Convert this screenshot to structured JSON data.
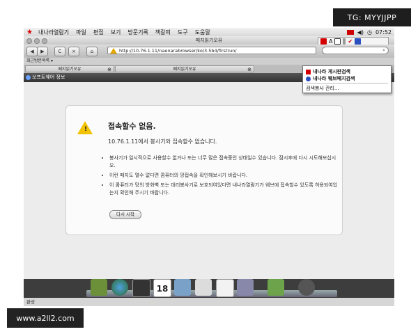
{
  "watermarks": {
    "top_right": "TG: MYYJJPP",
    "bottom_left": "www.a2ll2.com"
  },
  "menubar": {
    "items": [
      "내나라열람기",
      "파일",
      "편집",
      "보기",
      "방문기록",
      "책갈피",
      "도구",
      "도움말"
    ],
    "clock": "07:52"
  },
  "window": {
    "title": "페지읽기오유"
  },
  "toolbar": {
    "back_icon": "back-arrow-icon",
    "forward_icon": "forward-arrow-icon",
    "reload_glyph": "C",
    "stop_glyph": "×",
    "url": "http://10.76.1.11/naenarabrowser/ko/3.5b4/firstrun/"
  },
  "bookmarks": {
    "label": "최근방문목록 ▾"
  },
  "tabs": [
    {
      "label": "페지읽기오유"
    },
    {
      "label": "페지읽기오유"
    }
  ],
  "infobar": {
    "label": "쏘프트웨어 정보"
  },
  "error_page": {
    "title": "접속할수 없음.",
    "subtitle": "10.76.1.11에서 봉사기와 접속할수 없습니다.",
    "bullets": [
      "봉사기가 일시적으로 사용할수 없거나 또는 너무 많은 접속중인 상태일수 있습니다. 잠시후에 다시 시도해보십시오.",
      "이런 페지도 열수 없다면 콤퓨터의 망접속을 확인해보시기 바랍니다.",
      "이 콤퓨터가 망의 방화벽 또는 대리봉사기로 보호되여있다면 내나라열람기가 웨브에 접속할수 있도록 허용되여있는지 확인해 주시기 바랍니다."
    ],
    "retry_label": "다시 시작"
  },
  "search_dropdown": {
    "items": [
      {
        "label": "내나라 게시판검색",
        "icon": "board-search-icon"
      },
      {
        "label": "내나라 웨브페지검색",
        "icon": "web-search-icon"
      }
    ],
    "manage_label": "검색봉사 관리..."
  },
  "statusbar": {
    "label": "완성"
  },
  "colors": {
    "accent_red": "#d40000",
    "warning_yellow": "#f2c200",
    "info_blue": "#6aa0ff"
  }
}
